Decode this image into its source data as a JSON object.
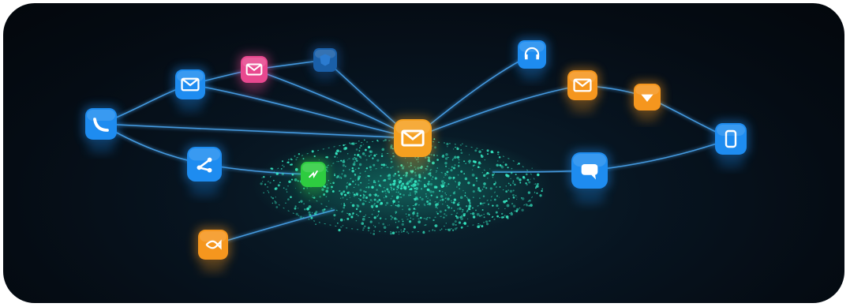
{
  "scene": {
    "background": "#050c14",
    "line_color": "#4fb0ff",
    "particle_color": "#37f0c8",
    "icons": [
      {
        "id": "phone-left",
        "name": "phone-icon",
        "color": "#1e8cf0",
        "glyph": "phone"
      },
      {
        "id": "mail-left",
        "name": "mail-icon",
        "color": "#1e8cf0",
        "glyph": "mail"
      },
      {
        "id": "chat-pink",
        "name": "chat-bubble-icon",
        "color": "#e8488f",
        "glyph": "mail"
      },
      {
        "id": "shield-top",
        "name": "shield-icon",
        "color": "#1a5fa8",
        "glyph": "shield"
      },
      {
        "id": "hub-mail",
        "name": "central-mail-icon",
        "color": "#f5a020",
        "glyph": "mail"
      },
      {
        "id": "headset",
        "name": "headset-icon",
        "color": "#1e8cf0",
        "glyph": "headset"
      },
      {
        "id": "mail-orange",
        "name": "mail-orange-icon",
        "color": "#f5961e",
        "glyph": "mail"
      },
      {
        "id": "download",
        "name": "download-icon",
        "color": "#f5961e",
        "glyph": "down"
      },
      {
        "id": "mobile",
        "name": "mobile-phone-icon",
        "color": "#1e8cf0",
        "glyph": "mobile"
      },
      {
        "id": "chat-right",
        "name": "chat-icon",
        "color": "#1e8cf0",
        "glyph": "chat"
      },
      {
        "id": "share",
        "name": "share-icon",
        "color": "#1e8cf0",
        "glyph": "share"
      },
      {
        "id": "signal-green",
        "name": "signal-icon",
        "color": "#2ecc40",
        "glyph": "signal"
      },
      {
        "id": "fish-orange",
        "name": "fish-icon",
        "color": "#f5961e",
        "glyph": "fish"
      }
    ]
  }
}
